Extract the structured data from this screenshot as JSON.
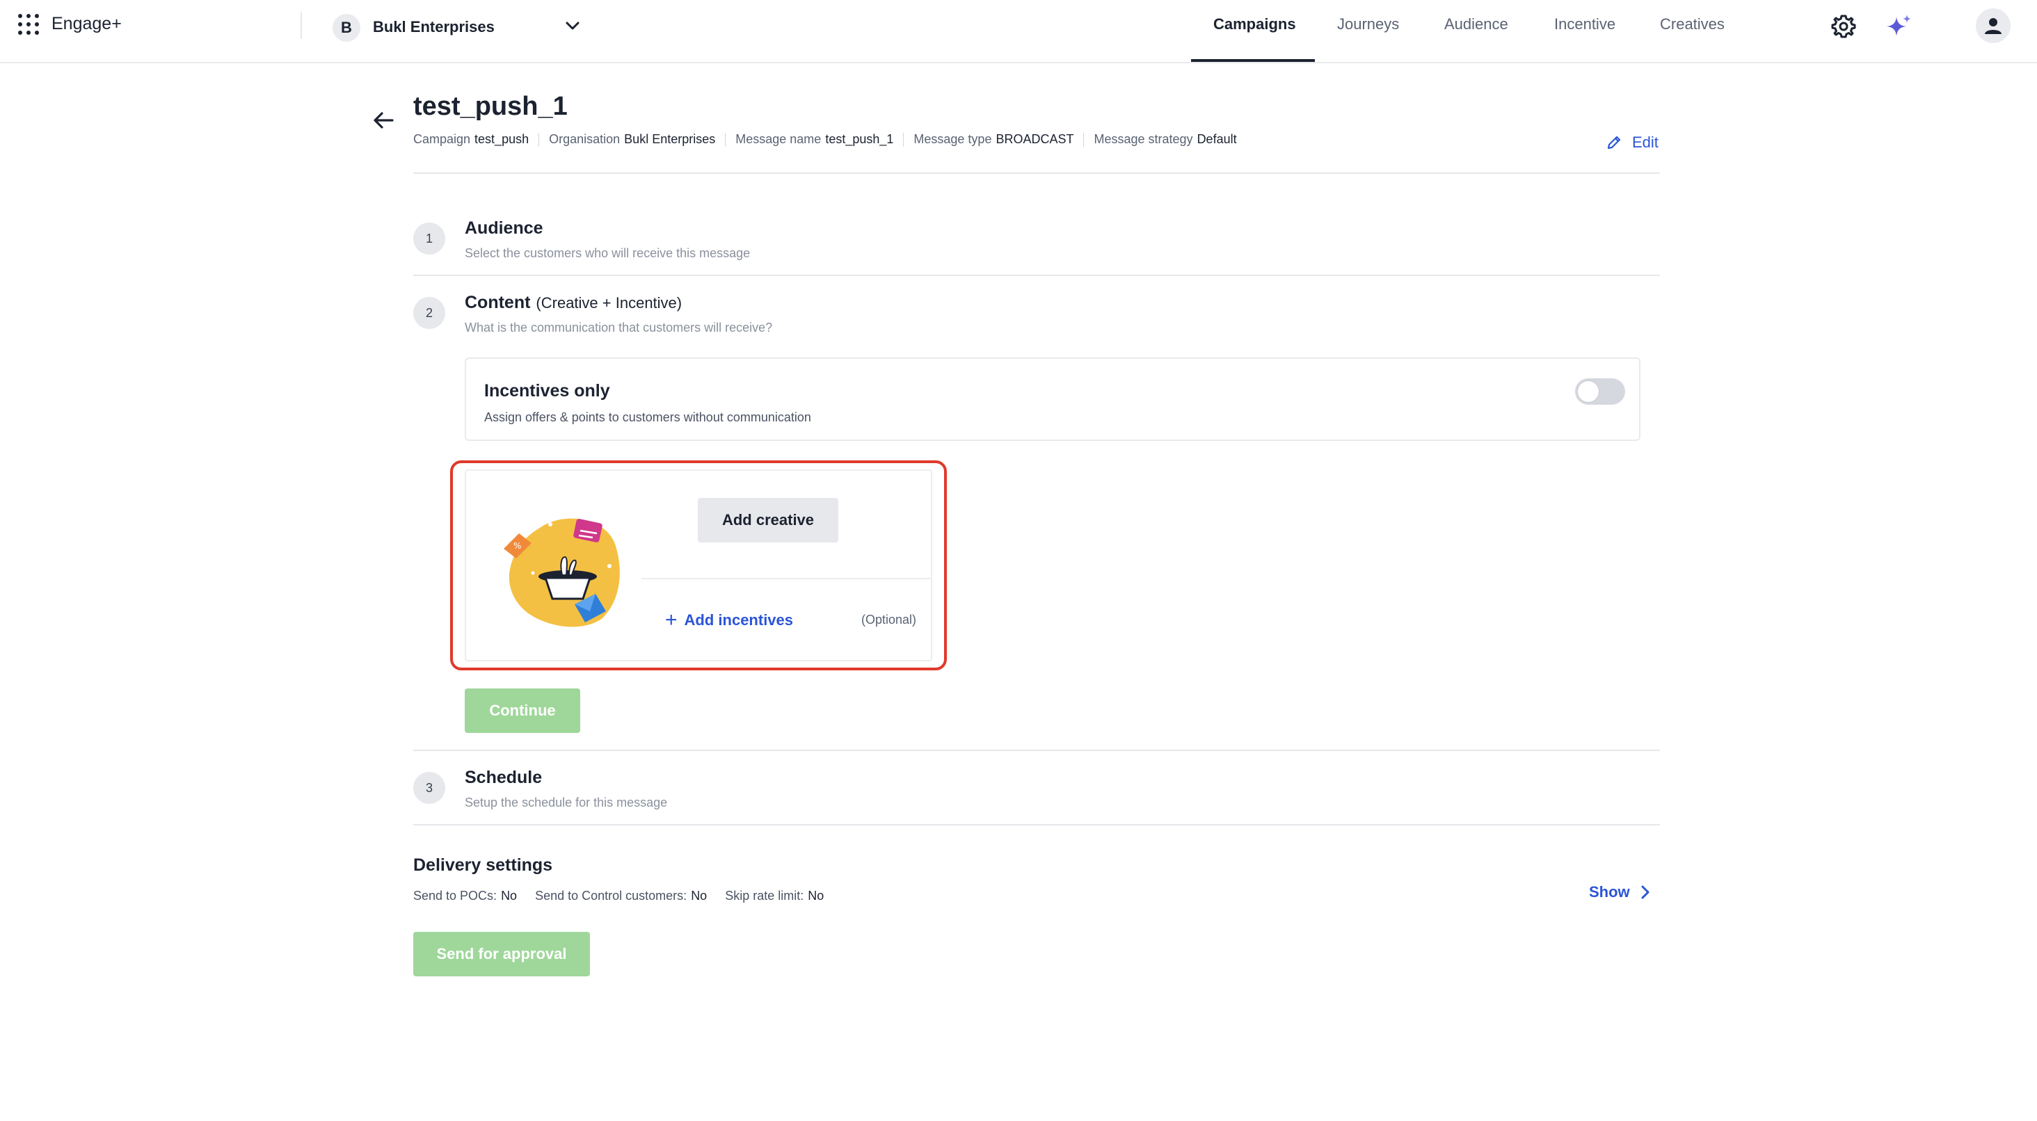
{
  "topbar": {
    "brand": "Engage+",
    "org_initial": "B",
    "org_name": "Bukl Enterprises",
    "nav": [
      "Campaigns",
      "Journeys",
      "Audience",
      "Incentive",
      "Creatives"
    ],
    "active_nav": "Campaigns"
  },
  "header": {
    "title": "test_push_1",
    "meta": [
      {
        "label": "Campaign",
        "value": "test_push"
      },
      {
        "label": "Organisation",
        "value": "Bukl Enterprises"
      },
      {
        "label": "Message name",
        "value": "test_push_1"
      },
      {
        "label": "Message type",
        "value": "BROADCAST"
      },
      {
        "label": "Message strategy",
        "value": "Default"
      }
    ],
    "edit_label": "Edit"
  },
  "steps": {
    "audience": {
      "num": "1",
      "title": "Audience",
      "desc": "Select the customers who will receive this message"
    },
    "content": {
      "num": "2",
      "title": "Content",
      "subtitle": "(Creative + Incentive)",
      "desc": "What is the communication that customers will receive?"
    },
    "schedule": {
      "num": "3",
      "title": "Schedule",
      "desc": "Setup the schedule for this message"
    }
  },
  "incentives_only": {
    "title": "Incentives only",
    "desc": "Assign offers & points to customers without communication",
    "enabled": false
  },
  "creative": {
    "add_creative_label": "Add creative",
    "add_incentives_label": "Add incentives",
    "optional_label": "(Optional)"
  },
  "continue_label": "Continue",
  "delivery": {
    "title": "Delivery settings",
    "items": [
      {
        "label": "Send to POCs:",
        "value": "No"
      },
      {
        "label": "Send to Control customers:",
        "value": "No"
      },
      {
        "label": "Skip rate limit:",
        "value": "No"
      }
    ],
    "show_label": "Show"
  },
  "send_label": "Send for approval",
  "colors": {
    "accent": "#2b55d6",
    "highlight": "#e0392b",
    "disabled_green": "#9fd79a"
  }
}
